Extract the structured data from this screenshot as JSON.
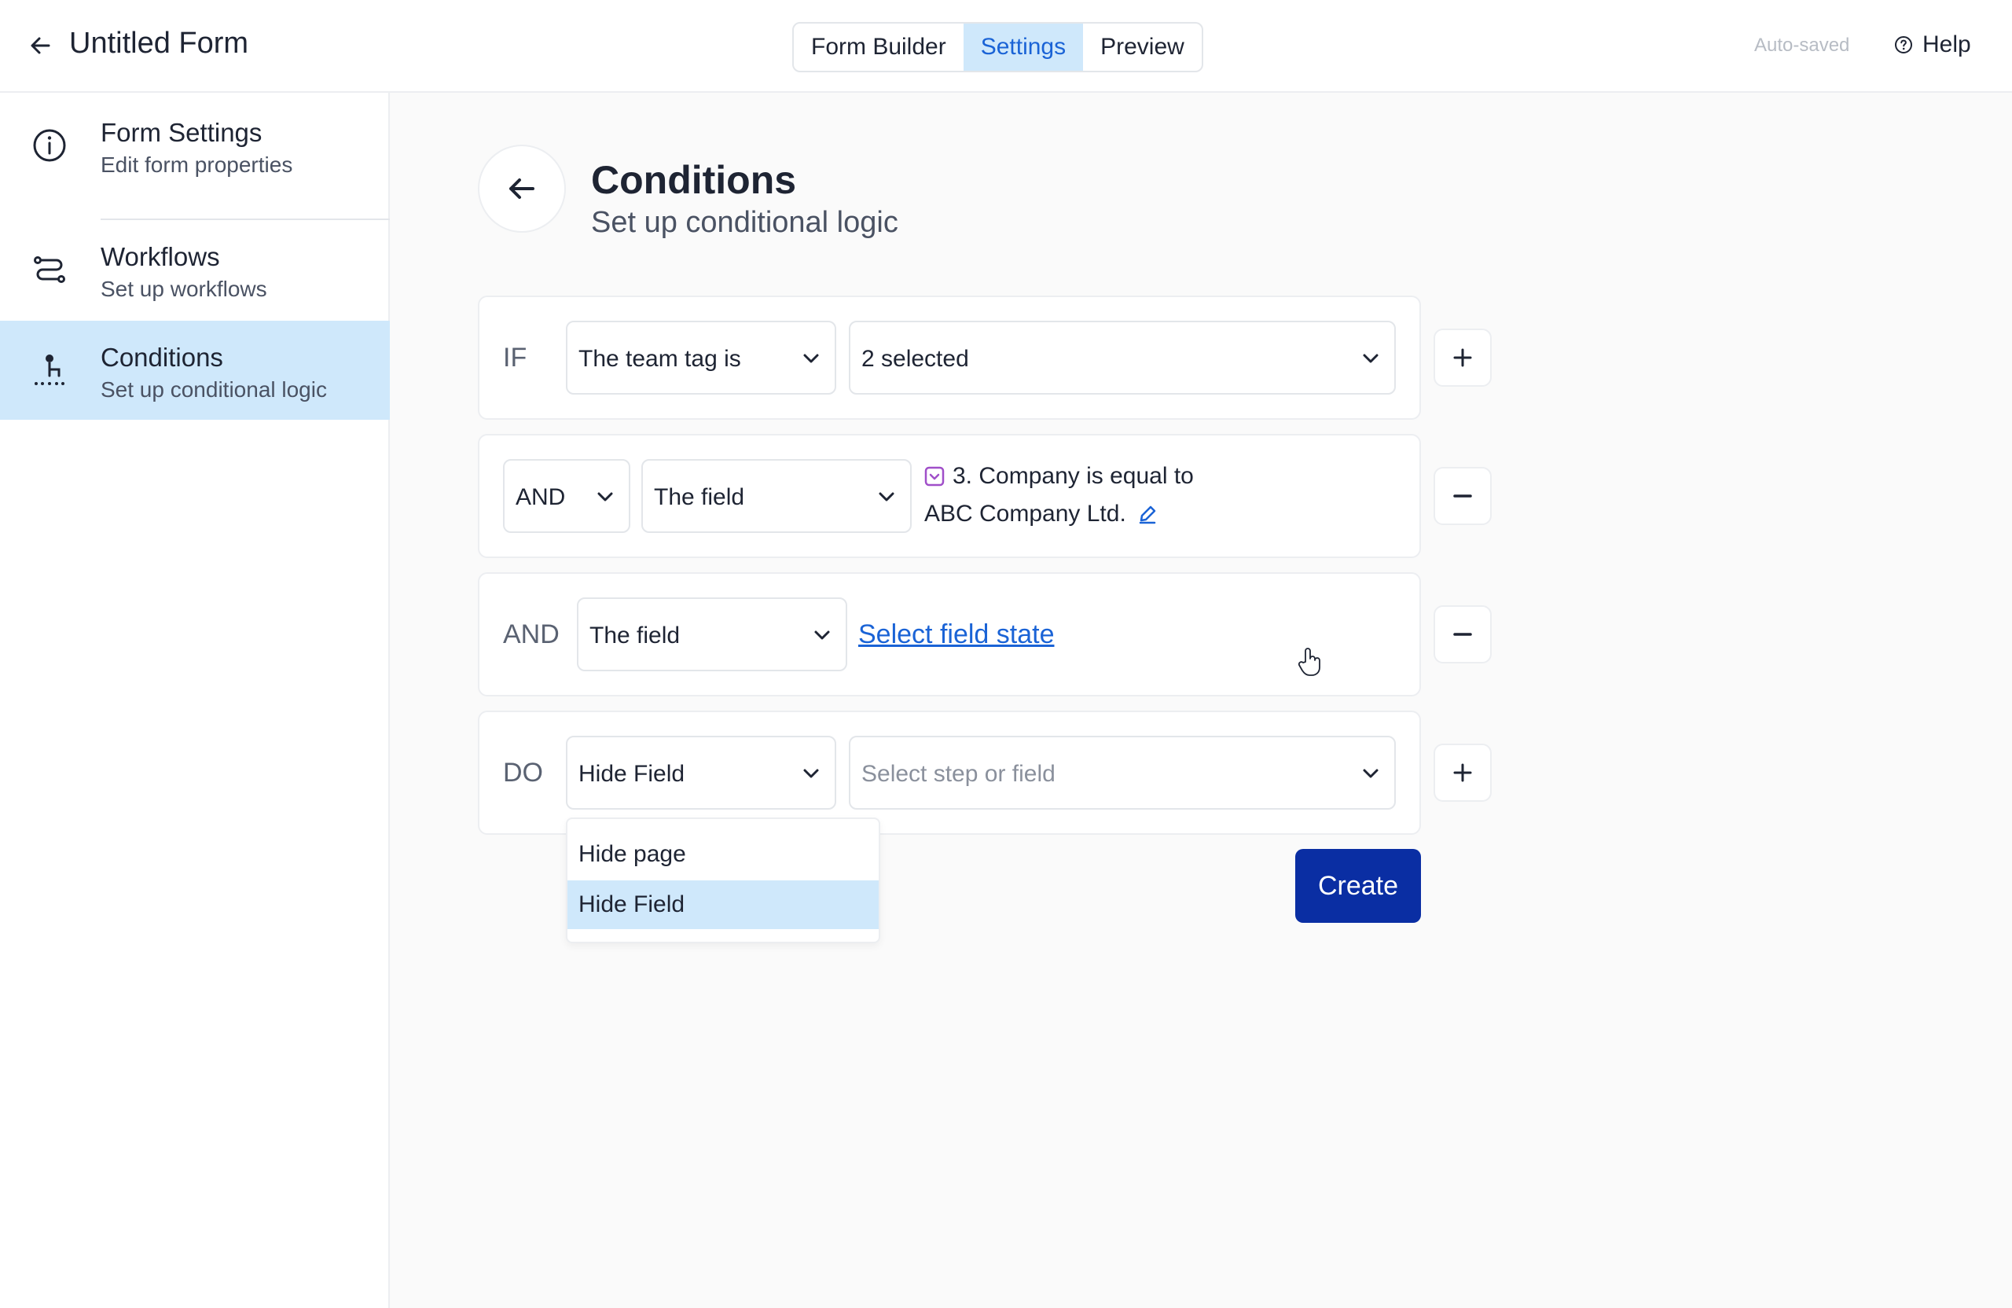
{
  "header": {
    "title": "Untitled Form",
    "tabs": [
      {
        "label": "Form Builder",
        "active": false
      },
      {
        "label": "Settings",
        "active": true
      },
      {
        "label": "Preview",
        "active": false
      }
    ],
    "status": "Auto-saved",
    "help_label": "Help"
  },
  "sidebar": {
    "items": [
      {
        "label": "Form Settings",
        "sub": "Edit form properties",
        "icon": "info-icon",
        "active": false
      },
      {
        "label": "Workflows",
        "sub": "Set up workflows",
        "icon": "workflow-icon",
        "active": false
      },
      {
        "label": "Conditions",
        "sub": "Set up conditional logic",
        "icon": "conditions-icon",
        "active": true
      }
    ]
  },
  "main": {
    "title": "Conditions",
    "subtitle": "Set up conditional logic",
    "if_row": {
      "keyword": "IF",
      "subject": "The team tag is",
      "value": "2 selected"
    },
    "and_row_1": {
      "operator": "AND",
      "subject": "The field",
      "condition_line1": "3. Company is equal to",
      "condition_line2": "ABC Company Ltd."
    },
    "and_row_2": {
      "keyword": "AND",
      "subject": "The field",
      "link": "Select field state"
    },
    "do_row": {
      "keyword": "DO",
      "action": "Hide Field",
      "target_placeholder": "Select step or field"
    },
    "action_options": [
      {
        "label": "Hide page",
        "selected": false
      },
      {
        "label": "Hide Field",
        "selected": true
      }
    ],
    "create_label": "Create"
  },
  "colors": {
    "accent": "#1a63d6",
    "active_bg": "#cfe8fb",
    "primary_button": "#0a2ea3",
    "field_icon": "#a04fc9"
  }
}
